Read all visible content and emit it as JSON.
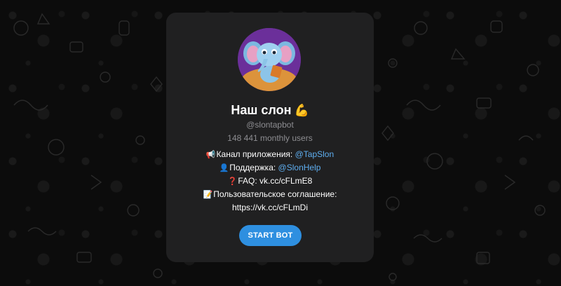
{
  "bot": {
    "name": "Наш слон",
    "name_emoji": "💪",
    "username": "@slontapbot",
    "monthly_users": "148 441 monthly users"
  },
  "description": {
    "channel_icon": "📢",
    "channel_label": "Канал приложения: ",
    "channel_link": "@TapSlon",
    "support_icon": "👤",
    "support_label": "Поддержка: ",
    "support_link": "@SlonHelp",
    "faq_icon": "❓",
    "faq_text": "FAQ: vk.cc/cFLmE8",
    "agreement_icon": "📝",
    "agreement_label": "Пользовательское соглашение:",
    "agreement_url": "https://vk.cc/cFLmDi"
  },
  "actions": {
    "start_label": "START BOT"
  },
  "icons": {
    "avatar": "elephant-avatar-icon",
    "name_emoji": "flexed-biceps-icon",
    "channel": "megaphone-icon",
    "support": "person-silhouette-icon",
    "faq": "question-mark-icon",
    "agreement": "memo-icon"
  },
  "colors": {
    "background": "#0c0c0c",
    "card": "#202021",
    "link": "#5eaef0",
    "button": "#2e8fe0",
    "muted_text": "#8d8d91"
  }
}
